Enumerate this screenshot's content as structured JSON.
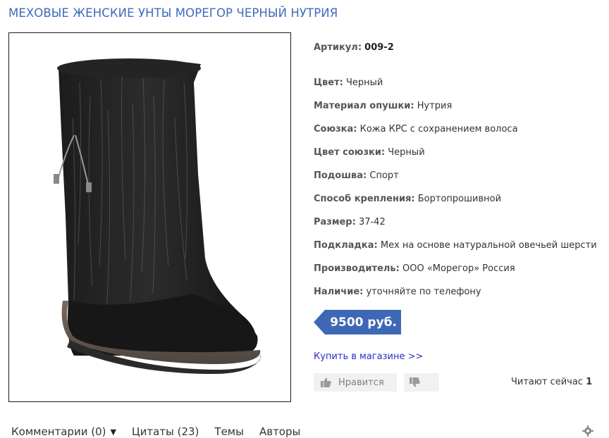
{
  "title": "МЕХОВЫЕ ЖЕНСКИЕ УНТЫ МОРЕГОР ЧЕРНЫЙ НУТРИЯ",
  "product_image": {
    "alt": "boot-photo",
    "icon": "fur-boot-image"
  },
  "props": [
    {
      "label": "Артикул:",
      "value": "009-2"
    },
    {
      "label": "Цвет:",
      "value": "Черный"
    },
    {
      "label": "Материал опушки:",
      "value": "Нутрия"
    },
    {
      "label": "Союзка:",
      "value": "Кожа КРС с сохранением волоса"
    },
    {
      "label": "Цвет союзки:",
      "value": "Черный"
    },
    {
      "label": "Подошва:",
      "value": "Спорт"
    },
    {
      "label": "Способ крепления:",
      "value": "Бортопрошивной"
    },
    {
      "label": "Размер:",
      "value": "37-42"
    },
    {
      "label": "Подкладка:",
      "value": "Мех на основе натуральной овечьей шерсти"
    },
    {
      "label": "Производитель:",
      "value": "ООО «Морегор» Россия"
    },
    {
      "label": "Наличие:",
      "value": "уточняйте по телефону"
    }
  ],
  "price": "9500 руб.",
  "buy_link": "Купить в магазине >>",
  "like_label": "Нравится",
  "reading": {
    "label": "Читают сейчас",
    "count": "1"
  },
  "tabs": [
    "Комментарии (0)",
    "Цитаты (23)",
    "Темы",
    "Авторы"
  ],
  "colors": {
    "title": "#3f6ab8",
    "price_bg": "#3e68b5",
    "link": "#2a2ac8"
  }
}
